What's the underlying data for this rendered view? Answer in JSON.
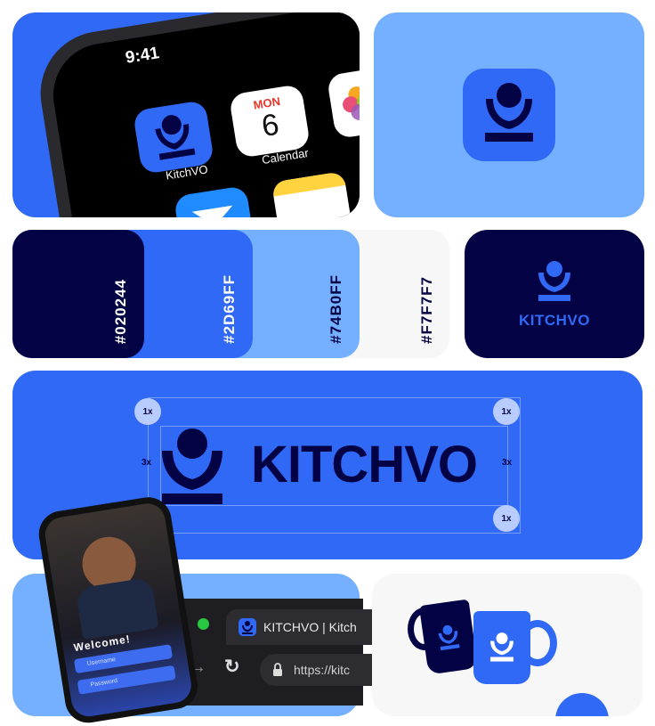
{
  "phone_home": {
    "time": "9:41",
    "apps": [
      {
        "label": "KitchVO",
        "icon": "kitchvo-logo-icon"
      },
      {
        "label": "Calendar",
        "icon": "calendar-icon",
        "month": "MON",
        "day": "6"
      }
    ]
  },
  "palette": [
    {
      "hex": "#020244"
    },
    {
      "hex": "#2D69FF"
    },
    {
      "hex": "#74B0FF"
    },
    {
      "hex": "#F7F7F7"
    }
  ],
  "logo_card": {
    "wordmark": "KITCHVO"
  },
  "clearspace": {
    "wordmark": "KITCHVO",
    "corner_label": "1x",
    "side_label": "3x"
  },
  "browser": {
    "tab_title": "KITCHVO | Kitch",
    "url": "https://kitc"
  },
  "login": {
    "welcome": "Welcome!",
    "username_placeholder": "Username",
    "password_placeholder": "Password"
  },
  "colors": {
    "navy": "#020244",
    "blue": "#2D69FF",
    "light_blue": "#74B0FF",
    "off_white": "#F7F7F7"
  }
}
